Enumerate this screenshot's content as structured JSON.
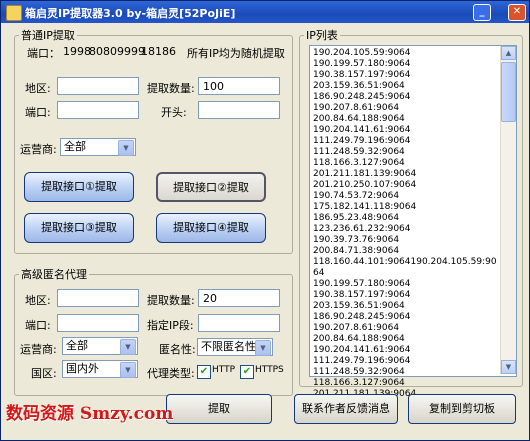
{
  "window": {
    "title": "箱启灵IP提取器3.0   by-箱启灵[52PoJiE]"
  },
  "normal": {
    "legend": "普通IP提取",
    "ports_label": "端口：",
    "ports": [
      "1998",
      "8080",
      "9999",
      "18186"
    ],
    "random_note": "所有IP均为随机提取",
    "region_label": "地区:",
    "region_value": "",
    "count_label": "提取数量:",
    "count_value": "100",
    "port_label": "端口:",
    "port_value": "",
    "prefix_label": "开头:",
    "prefix_value": "",
    "isp_label": "运营商:",
    "isp_value": "全部",
    "buttons": [
      "提取接口①提取",
      "提取接口②提取",
      "提取接口③提取",
      "提取接口④提取"
    ]
  },
  "advanced": {
    "legend": "高级匿名代理",
    "region_label": "地区:",
    "region_value": "",
    "count_label": "提取数量:",
    "count_value": "20",
    "port_label": "端口:",
    "port_value": "",
    "seg_label": "指定IP段:",
    "seg_value": "",
    "isp_label": "运营商:",
    "isp_value": "全部",
    "anon_label": "匿名性:",
    "anon_value": "不限匿名性",
    "country_label": "国区:",
    "country_value": "国内外",
    "type_label": "代理类型:",
    "http_label": "HTTP",
    "http_checked": true,
    "https_label": "HTTPS",
    "https_checked": true,
    "extract_label": "提取"
  },
  "iplist": {
    "legend": "IP列表",
    "text": "190.204.105.59:9064\n190.199.57.180:9064\n190.38.157.197:9064\n203.159.36.51:9064\n186.90.248.245:9064\n190.207.8.61:9064\n200.84.64.188:9064\n190.204.141.61:9064\n111.249.79.196:9064\n111.248.59.32:9064\n118.166.3.127:9064\n201.211.181.139:9064\n201.210.250.107:9064\n190.74.53.72:9064\n175.182.141.118:9064\n186.95.23.48:9064\n123.236.61.232:9064\n190.39.73.76:9064\n200.84.71.38:9064\n118.160.44.101:9064190.204.105.59:9064\n190.199.57.180:9064\n190.38.157.197:9064\n203.159.36.51:9064\n186.90.248.245:9064\n190.207.8.61:9064\n200.84.64.188:9064\n190.204.141.61:9064\n111.249.79.196:9064\n111.248.59.32:9064\n118.166.3.127:9064\n201.211.181.139:9064"
  },
  "actions": {
    "feedback": "联系作者反馈消息",
    "copy": "复制到剪切板"
  },
  "watermark": "数码资源 Smzy.com"
}
